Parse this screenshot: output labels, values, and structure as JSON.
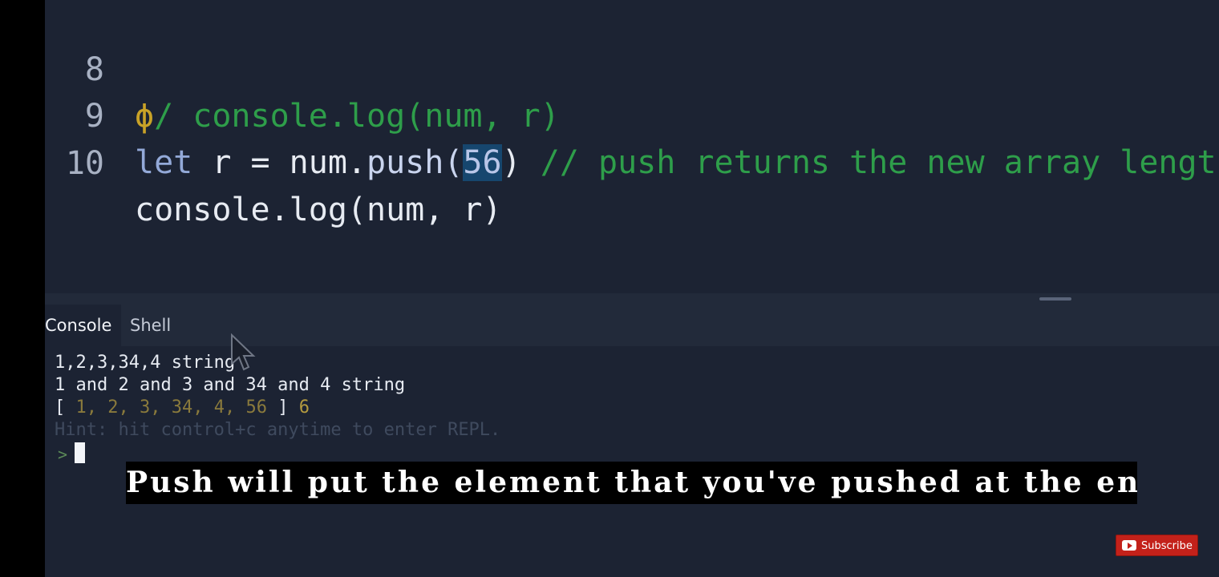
{
  "editor": {
    "lines": [
      {
        "number": "8",
        "mark": "ϕ",
        "text": "/ console.log(num, r)"
      },
      {
        "number": "9",
        "kw": "let",
        "pre": " r = num.",
        "method": "push(",
        "arg": "56",
        "post": ")",
        "comment": " // push returns the new array length"
      },
      {
        "number": "10",
        "text": "console.log(num, r)"
      }
    ]
  },
  "console": {
    "tabs": [
      {
        "label": "Console",
        "active": true
      },
      {
        "label": "Shell",
        "active": false
      }
    ],
    "output": [
      "1,2,3,34,4 string",
      "1 and 2 and 3 and 34 and 4 string"
    ],
    "array_line": {
      "open": "[ ",
      "items": [
        "1",
        "2",
        "3",
        "34",
        "4",
        "56"
      ],
      "close": " ]",
      "result": "6"
    },
    "hint": "Hint: hit control+c anytime to enter REPL.",
    "prompt": ">"
  },
  "caption": "Push will put the element that you've pushed at the end. Okay?",
  "subscribe": {
    "label": "Subscribe",
    "icon": "youtube-play-icon"
  },
  "colors": {
    "editor_bg": "#1c2333",
    "comment": "#2e9e4a",
    "keyword": "#93a9d8",
    "subscribe_red": "#c3211a"
  }
}
